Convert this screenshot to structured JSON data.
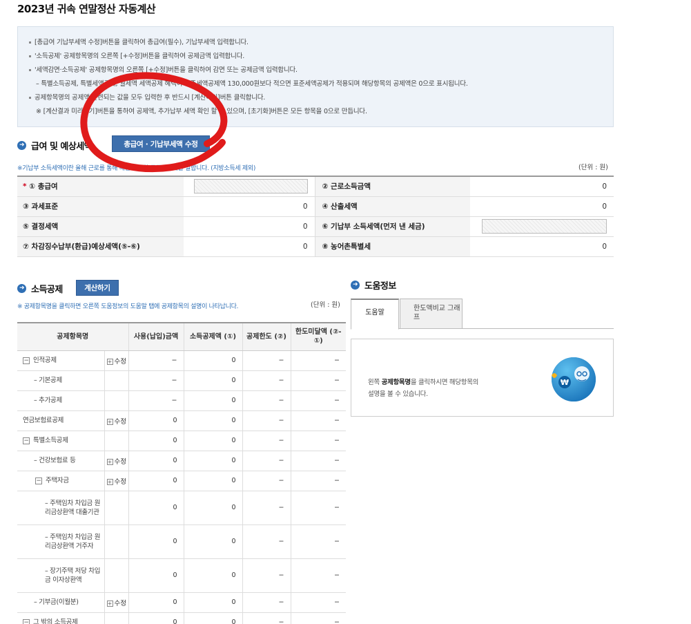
{
  "page_title": "2023년 귀속 연말정산 자동계산",
  "notices": [
    {
      "text": "[총급여 기납부세액 수정]버튼을 클릭하여 총급여(필수), 기납부세액 입력합니다.",
      "sub": false
    },
    {
      "text": "'소득공제' 공제항목명의 오른쪽 [+수정]버튼을 클릭하여 공제금액 입력합니다.",
      "sub": false
    },
    {
      "text": "'세액감면·소득공제' 공제항목명의 오른쪽 [+수정]버튼을 클릭하여 감면 또는 공제금액 입력합니다.",
      "sub": false
    },
    {
      "text": "– 특별소득공제, 특별세액공제, 월세액 세액공제 혜택이 표준세액공제액 130,000원보다 적으면 표준세액공제가 적용되며 해당항목의 공제액은 0으로 표시됩니다.",
      "sub": true
    },
    {
      "text": "공제항목명의 공제액 관련되는 값을 모두 입력한 후 반드시 [계산하기]버튼 클릭합니다.",
      "sub": false
    },
    {
      "text": "※ [계산결과 미리보기]버튼을 통하여 공제액, 추가납부 세액 확인 할 수 있으며, [초기화]버튼은 모든 항목을 0으로 만듭니다.",
      "sub": true
    }
  ],
  "salary_section": {
    "title": "급여 및 예상세액",
    "edit_button": "총급여 · 기납부세액 수정",
    "note": "※기납부 소득세액이란 올해 근로를 통해 매월 납부한 근로소득세를 말합니다. (지방소득세 제외)",
    "unit": "(단위 : 원)",
    "rows": [
      {
        "left_label": "① 총급여",
        "left_value": "",
        "left_required": "*",
        "right_label": "② 근로소득금액",
        "right_value": "0"
      },
      {
        "left_label": "③ 과세표준",
        "left_value": "0",
        "left_required": "",
        "right_label": "④ 산출세액",
        "right_value": "0"
      },
      {
        "left_label": "⑤ 결정세액",
        "left_value": "0",
        "left_required": "",
        "right_label": "⑥ 기납부 소득세액(먼저 낸 세금)",
        "right_value": ""
      },
      {
        "left_label": "⑦ 차감징수납부(환급)예상세액(⑤-⑥)",
        "left_value": "0",
        "left_required": "",
        "right_label": "⑧ 농어촌특별세",
        "right_value": "0"
      }
    ]
  },
  "deduction_section": {
    "title": "소득공제",
    "calc_button": "계산하기",
    "note": "※ 공제항목명을 클릭하면 오른쪽 도움정보의 도움말 탭에 공제항목의 설명이 나타납니다.",
    "unit": "(단위 : 원)",
    "headers": [
      "공제항목명",
      "",
      "사용(납입)금액",
      "소득공제액 (①)",
      "공제한도 (②)",
      "한도미달액 (②-①)"
    ],
    "rows": [
      {
        "name": "인적공제",
        "toggle": "−",
        "indent": 0,
        "edit": "수정",
        "used": "−",
        "deduct": "0",
        "limit": "−",
        "short": "−",
        "h": 29
      },
      {
        "name": "– 기본공제",
        "toggle": "",
        "indent": 1,
        "edit": "",
        "used": "−",
        "deduct": "0",
        "limit": "−",
        "short": "−",
        "h": 29
      },
      {
        "name": "– 추가공제",
        "toggle": "",
        "indent": 1,
        "edit": "",
        "used": "−",
        "deduct": "0",
        "limit": "−",
        "short": "−",
        "h": 29
      },
      {
        "name": "연금보험료공제",
        "toggle": "",
        "indent": 0,
        "edit": "수정",
        "used": "0",
        "deduct": "0",
        "limit": "−",
        "short": "−",
        "h": 29
      },
      {
        "name": "특별소득공제",
        "toggle": "−",
        "indent": 0,
        "edit": "",
        "used": "0",
        "deduct": "0",
        "limit": "−",
        "short": "−",
        "h": 29
      },
      {
        "name": "– 건강보험료 등",
        "toggle": "",
        "indent": 1,
        "edit": "수정",
        "used": "0",
        "deduct": "0",
        "limit": "−",
        "short": "−",
        "h": 29
      },
      {
        "name": "주택자금",
        "toggle": "−",
        "indent": 2,
        "edit": "수정",
        "used": "0",
        "deduct": "0",
        "limit": "−",
        "short": "−",
        "h": 29
      },
      {
        "name": "– 주택임차 차입금 원리금상환액 대출기관",
        "toggle": "",
        "indent": 3,
        "edit": "",
        "used": "0",
        "deduct": "0",
        "limit": "−",
        "short": "−",
        "h": 49
      },
      {
        "name": "– 주택임차 차입금 원리금상환액 거주자",
        "toggle": "",
        "indent": 3,
        "edit": "",
        "used": "0",
        "deduct": "0",
        "limit": "−",
        "short": "−",
        "h": 49
      },
      {
        "name": "– 장기주택 저당 차입금 이자상환액",
        "toggle": "",
        "indent": 3,
        "edit": "",
        "used": "0",
        "deduct": "0",
        "limit": "−",
        "short": "−",
        "h": 49
      },
      {
        "name": "– 기부금(이월분)",
        "toggle": "",
        "indent": 1,
        "edit": "수정",
        "used": "0",
        "deduct": "0",
        "limit": "−",
        "short": "−",
        "h": 29
      },
      {
        "name": "그 밖의 소득공제",
        "toggle": "−",
        "indent": 0,
        "edit": "",
        "used": "0",
        "deduct": "0",
        "limit": "−",
        "short": "−",
        "h": 29
      }
    ]
  },
  "help_section": {
    "title": "도움정보",
    "tabs": [
      {
        "label": "도움말",
        "active": true
      },
      {
        "label": "한도액비교 그래프",
        "active": false
      }
    ],
    "text_prefix": "왼쪽 ",
    "text_bold": "공제항목명",
    "text_suffix": "을 클릭하시면 해당항목의",
    "text_line2": "설명을 볼 수 있습니다.",
    "mascot": "won-mascot-icon"
  },
  "colors": {
    "accent": "#3d6fad",
    "annotation": "#e01b1b",
    "note": "#2f6fb5"
  }
}
